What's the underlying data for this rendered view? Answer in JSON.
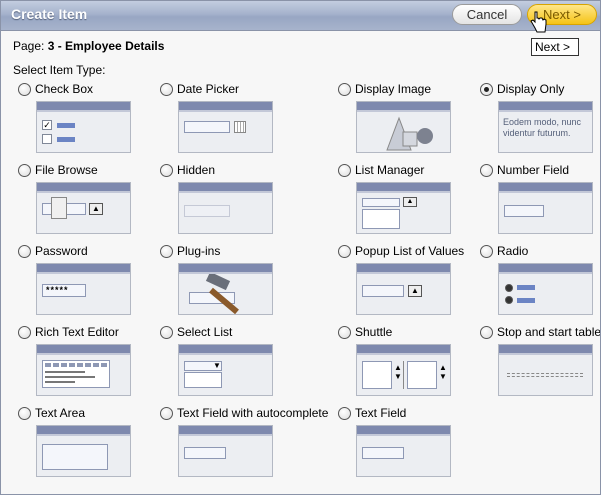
{
  "dialog": {
    "title": "Create Item",
    "cancel_label": "Cancel",
    "next_label": "Next >",
    "tooltip": "Next >"
  },
  "page": {
    "label": "Page:",
    "value": "3 - Employee Details"
  },
  "select_item_type_label": "Select Item Type:",
  "options": [
    {
      "label": "Check Box",
      "selected": false
    },
    {
      "label": "Date Picker",
      "selected": false
    },
    {
      "label": "Display Image",
      "selected": false
    },
    {
      "label": "Display Only",
      "selected": true
    },
    {
      "label": "File Browse",
      "selected": false
    },
    {
      "label": "Hidden",
      "selected": false
    },
    {
      "label": "List Manager",
      "selected": false
    },
    {
      "label": "Number Field",
      "selected": false
    },
    {
      "label": "Password",
      "selected": false
    },
    {
      "label": "Plug-ins",
      "selected": false
    },
    {
      "label": "Popup List of Values",
      "selected": false
    },
    {
      "label": "Radio",
      "selected": false
    },
    {
      "label": "Rich Text Editor",
      "selected": false
    },
    {
      "label": "Select List",
      "selected": false
    },
    {
      "label": "Shuttle",
      "selected": false
    },
    {
      "label": "Stop and start table",
      "selected": false
    },
    {
      "label": "Text Area",
      "selected": false
    },
    {
      "label": "Text Field with autocomplete",
      "selected": false
    },
    {
      "label": "Text Field",
      "selected": false
    }
  ],
  "thumb_text": {
    "display_only": "Eodem modo, nunc videntur futurum.",
    "password": "*****"
  },
  "colors": {
    "title_bar": "#a5b2cc",
    "next_button": "#f5c316",
    "thumb_header": "#7e89ae"
  }
}
